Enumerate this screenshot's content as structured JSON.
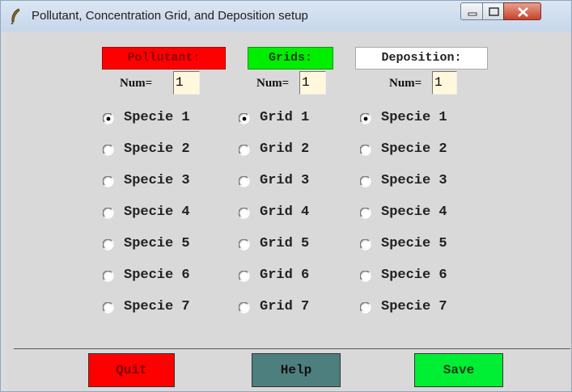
{
  "window": {
    "title": "Pollutant, Concentration Grid, and Deposition setup",
    "icon": "feather-icon",
    "controls": [
      "minimize-icon",
      "maximize-icon",
      "close-icon"
    ]
  },
  "headers": {
    "pollutant": "Pollutant:",
    "grids": "Grids:",
    "deposition": "Deposition:"
  },
  "num_label": "Num=",
  "num_values": {
    "pollutant": "1",
    "grids": "1",
    "deposition": "1"
  },
  "pollutant_options": [
    "Specie 1",
    "Specie 2",
    "Specie 3",
    "Specie 4",
    "Specie 5",
    "Specie 6",
    "Specie 7"
  ],
  "grid_options": [
    "Grid 1",
    "Grid 2",
    "Grid 3",
    "Grid 4",
    "Grid 5",
    "Grid 6",
    "Grid 7"
  ],
  "deposition_options": [
    "Specie 1",
    "Specie 2",
    "Specie 3",
    "Specie 4",
    "Specie 5",
    "Specie 6",
    "Specie 7"
  ],
  "selected": {
    "pollutant": "Specie 1",
    "grids": "Grid 1",
    "deposition": "Specie 1"
  },
  "buttons": {
    "quit": "Quit",
    "help": "Help",
    "save": "Save"
  },
  "colors": {
    "pollutant_header": "#ff0000",
    "grids_header": "#00ee00",
    "deposition_header": "#ffffff",
    "quit_button": "#ff0000",
    "help_button": "#4e7f7f",
    "save_button": "#00ee33",
    "input_background": "#fff8dc"
  }
}
